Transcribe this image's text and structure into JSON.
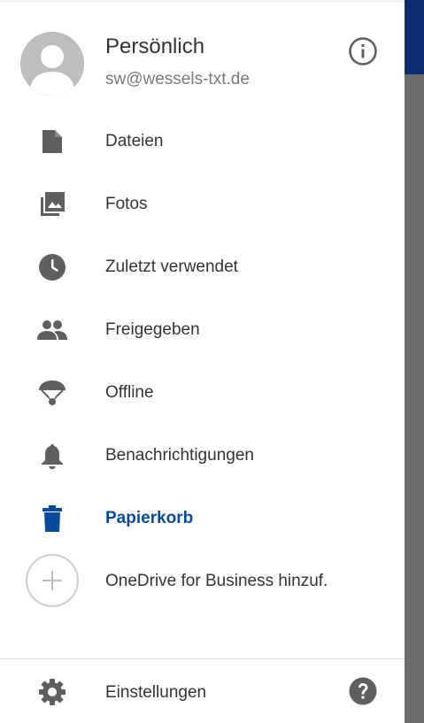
{
  "account": {
    "name": "Persönlich",
    "email": "sw@wessels-txt.de"
  },
  "menu": {
    "items": [
      {
        "label": "Dateien",
        "icon": "file-icon"
      },
      {
        "label": "Fotos",
        "icon": "photos-icon"
      },
      {
        "label": "Zuletzt verwendet",
        "icon": "clock-icon"
      },
      {
        "label": "Freigegeben",
        "icon": "people-icon"
      },
      {
        "label": "Offline",
        "icon": "offline-parachute-icon"
      },
      {
        "label": "Benachrichtigungen",
        "icon": "bell-icon"
      },
      {
        "label": "Papierkorb",
        "icon": "trash-icon",
        "active": true
      },
      {
        "label": "OneDrive for Business hinzuf.",
        "icon": "plus-icon"
      }
    ]
  },
  "footer": {
    "settings_label": "Einstellungen"
  },
  "colors": {
    "accent": "#0a4a9c",
    "icon": "#5f5f5f",
    "text": "#333333",
    "app_bar": "#0b2d70",
    "scrim": "#6b6b6b"
  }
}
